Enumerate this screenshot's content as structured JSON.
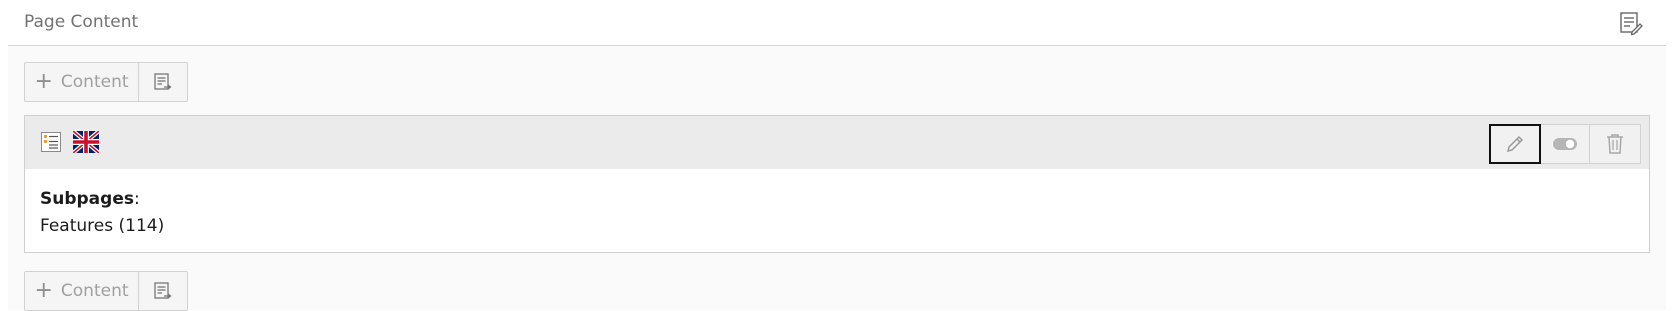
{
  "panel": {
    "title": "Page Content",
    "header_icon": "edit-page-icon"
  },
  "toolbar_top": {
    "add_label": "Content",
    "add_icon": "plus-icon",
    "paste_icon": "paste-icon"
  },
  "content_element": {
    "type_icon": "menu-subpages-icon",
    "language_icon": "uk-flag-icon",
    "actions": {
      "edit_icon": "pencil-icon",
      "toggle_icon": "toggle-icon",
      "delete_icon": "trash-icon"
    },
    "heading": "Subpages",
    "heading_colon": ":",
    "item": "Features (114)"
  },
  "toolbar_bottom": {
    "add_label": "Content",
    "add_icon": "plus-icon",
    "paste_icon": "paste-icon"
  }
}
